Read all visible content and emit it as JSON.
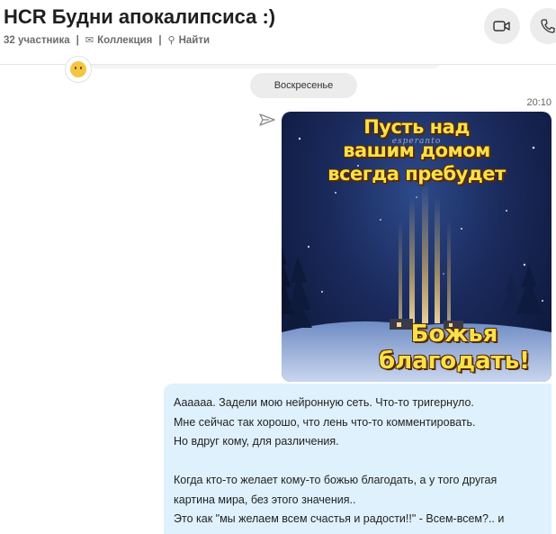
{
  "header": {
    "title": "HCR Будни апокалипсиса :)",
    "participants": "32 участника",
    "collection": "Коллекция",
    "find": "Найти"
  },
  "chat": {
    "day_separator": "Воскресенье",
    "message_time": "20:10",
    "image": {
      "caption_top": [
        "Пусть над",
        "вашим домом",
        "всегда пребудет"
      ],
      "caption_bottom": [
        "Божья",
        "благодать!"
      ],
      "watermark": "esperanto"
    },
    "message_lines": [
      "Аааааа. Задели мою нейронную сеть. Что-то тригернуло.",
      "Мне сейчас так хорошо, что лень что-то комментировать.",
      "Но вдруг кому, для различения.",
      "",
      "Когда кто-то желает кому-то божью благодать, а у того другая",
      "картина мира, без этого значения..",
      "Это как \"мы желаем всем счастья и радости!!\" - Всем-всем?.. и"
    ]
  },
  "icons": {
    "participants": "people-icon",
    "collection": "gallery-icon",
    "find": "search-icon",
    "video_call": "video-camera-icon",
    "audio_call": "phone-icon",
    "status": "sent-icon"
  },
  "colors": {
    "outgoing_bubble": "#dff1fd",
    "header_button": "#ececec",
    "image_text": "#f7e14a"
  }
}
